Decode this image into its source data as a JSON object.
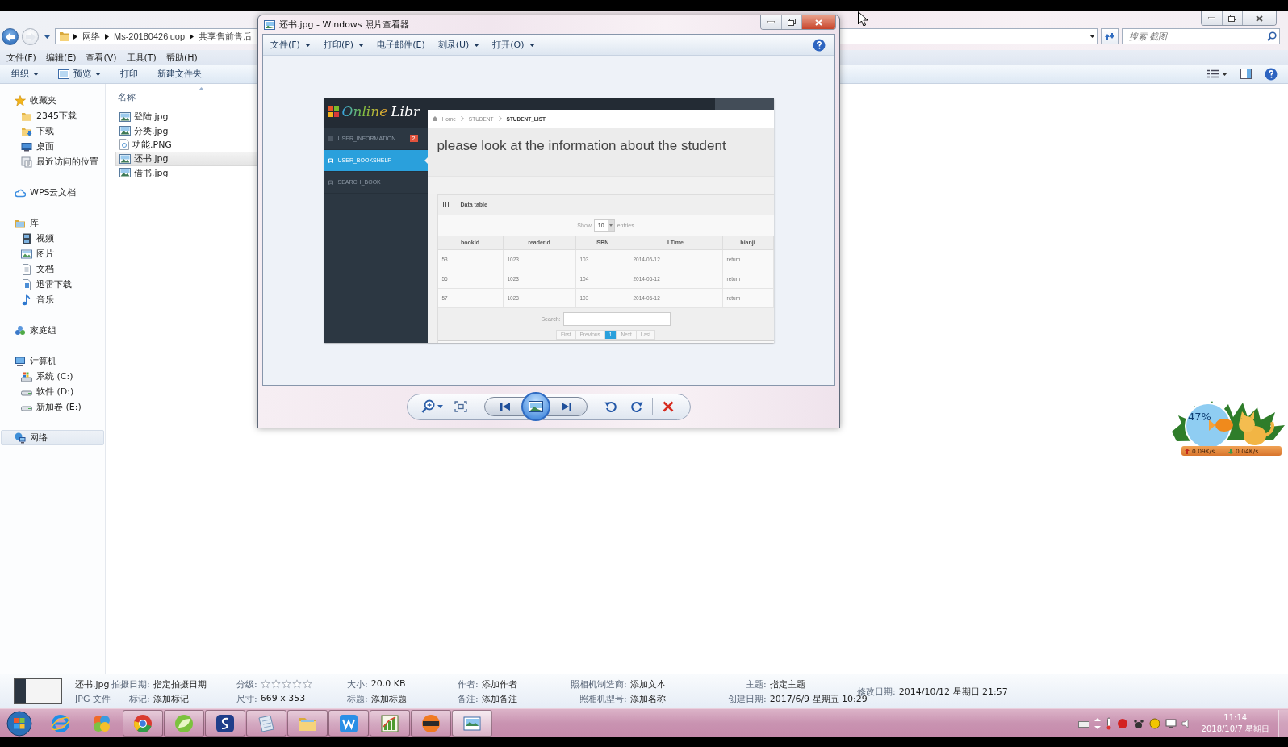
{
  "explorer": {
    "breadcrumb": [
      "网络",
      "Ms-20180426iuop",
      "共享售前售后"
    ],
    "search": {
      "placeholder": "搜索 截图"
    },
    "menu": [
      "文件(F)",
      "编辑(E)",
      "查看(V)",
      "工具(T)",
      "帮助(H)"
    ],
    "toolbar": [
      {
        "label": "组织",
        "kind": "dropdown"
      },
      {
        "label": "预览",
        "kind": "icon-dropdown"
      },
      {
        "label": "打印",
        "kind": "plain"
      },
      {
        "label": "新建文件夹",
        "kind": "plain"
      }
    ],
    "nav": [
      {
        "label": "收藏夹",
        "kind": "star",
        "selected": false,
        "children": [
          {
            "label": "2345下载",
            "kind": "folder",
            "selected": false
          },
          {
            "label": "下载",
            "kind": "download",
            "selected": false
          },
          {
            "label": "桌面",
            "kind": "desktop",
            "selected": false
          },
          {
            "label": "最近访问的位置",
            "kind": "recent",
            "selected": false
          }
        ]
      },
      {
        "label": "WPS云文档",
        "kind": "cloud",
        "selected": false
      },
      {
        "label": "库",
        "kind": "library",
        "selected": false,
        "children": [
          {
            "label": "视频",
            "kind": "video",
            "selected": false
          },
          {
            "label": "图片",
            "kind": "picture",
            "selected": false
          },
          {
            "label": "文档",
            "kind": "document",
            "selected": false
          },
          {
            "label": "迅雷下载",
            "kind": "thunder",
            "selected": false
          },
          {
            "label": "音乐",
            "kind": "music",
            "selected": false
          }
        ]
      },
      {
        "label": "家庭组",
        "kind": "homegroup",
        "selected": false
      },
      {
        "label": "计算机",
        "kind": "computer",
        "selected": false,
        "children": [
          {
            "label": "系统 (C:)",
            "kind": "system-drive",
            "selected": false
          },
          {
            "label": "软件 (D:)",
            "kind": "drive",
            "selected": false
          },
          {
            "label": "新加卷 (E:)",
            "kind": "drive",
            "selected": false
          }
        ]
      },
      {
        "label": "网络",
        "kind": "network",
        "selected": true
      }
    ],
    "column": "名称",
    "files": [
      {
        "name": "登陆.jpg",
        "kind": "image",
        "selected": false
      },
      {
        "name": "分类.jpg",
        "kind": "image",
        "selected": false
      },
      {
        "name": "功能.PNG",
        "kind": "file",
        "selected": false
      },
      {
        "name": "还书.jpg",
        "kind": "image",
        "selected": true
      },
      {
        "name": "借书.jpg",
        "kind": "image",
        "selected": false
      }
    ],
    "details": {
      "name": "还书.jpg",
      "type": "JPG 文件",
      "columns": [
        [
          {
            "label": "拍摄日期:",
            "kind": "text",
            "value": "指定拍摄日期"
          },
          {
            "label": "标记:",
            "kind": "text",
            "value": "添加标记"
          }
        ],
        [
          {
            "label": "分级:",
            "kind": "rating",
            "stars": 0
          },
          {
            "label": "尺寸:",
            "kind": "text",
            "value": "669 x 353"
          }
        ],
        [
          {
            "label": "大小:",
            "kind": "text",
            "value": "20.0 KB"
          },
          {
            "label": "标题:",
            "kind": "text",
            "value": "添加标题"
          }
        ],
        [
          {
            "label": "作者:",
            "kind": "text",
            "value": "添加作者"
          },
          {
            "label": "备注:",
            "kind": "text",
            "value": "添加备注"
          }
        ],
        [
          {
            "label": "照相机制造商:",
            "kind": "text",
            "value": "添加文本"
          },
          {
            "label": "照相机型号:",
            "kind": "text",
            "value": "添加名称"
          }
        ],
        [
          {
            "label": "主题:",
            "kind": "text",
            "value": "指定主题"
          },
          {
            "label": "创建日期:",
            "kind": "text",
            "value": "2017/6/9 星期五 10:29"
          }
        ],
        [
          {
            "label": "修改日期:",
            "kind": "text",
            "value": "2014/10/12 星期日 21:57"
          }
        ]
      ]
    }
  },
  "viewer": {
    "title": "还书.jpg - Windows 照片查看器",
    "menu": [
      {
        "label": "文件(F)",
        "dropdown": true
      },
      {
        "label": "打印(P)",
        "dropdown": true
      },
      {
        "label": "电子邮件(E)",
        "dropdown": false
      },
      {
        "label": "刻录(U)",
        "dropdown": true
      },
      {
        "label": "打开(O)",
        "dropdown": true
      }
    ],
    "page": {
      "logo_accent": "Online",
      "logo_rest": "Libr",
      "menu": [
        {
          "label": "USER_INFORMATION",
          "badge": "2",
          "selected": false
        },
        {
          "label": "USER_BOOKSHELF",
          "selected": true
        },
        {
          "label": "SEARCH_BOOK",
          "selected": false
        }
      ],
      "breadcrumb": [
        "Home",
        "STUDENT",
        "STUDENT_LIST"
      ],
      "heading": "please look at the information about the student",
      "panel_title": "Data table",
      "show_label": "Show",
      "page_size": "10",
      "entries_label": "entries",
      "columns": [
        "bookId",
        "readerId",
        "ISBN",
        "LTime",
        "bianji"
      ],
      "rows": [
        [
          "53",
          "1023",
          "103",
          "2014-06-12",
          "return"
        ],
        [
          "56",
          "1023",
          "104",
          "2014-06-12",
          "return"
        ],
        [
          "57",
          "1023",
          "103",
          "2014-06-12",
          "return"
        ]
      ],
      "search_label": "Search:",
      "pagination": [
        {
          "label": "First",
          "selected": false
        },
        {
          "label": "Previous",
          "selected": false
        },
        {
          "label": "1",
          "selected": true
        },
        {
          "label": "Next",
          "selected": false
        },
        {
          "label": "Last",
          "selected": false
        }
      ]
    }
  },
  "taskbar": {
    "apps": [
      {
        "kind": "ie",
        "running": false,
        "selected": false
      },
      {
        "kind": "pinwheel",
        "running": false,
        "selected": false
      },
      {
        "kind": "chrome",
        "running": true,
        "selected": false
      },
      {
        "kind": "leaf",
        "running": true,
        "selected": false
      },
      {
        "kind": "swirl",
        "running": true,
        "selected": false
      },
      {
        "kind": "notepad",
        "running": true,
        "selected": false
      },
      {
        "kind": "folder",
        "running": true,
        "selected": false
      },
      {
        "kind": "zigzag",
        "running": true,
        "selected": false
      },
      {
        "kind": "chart",
        "running": true,
        "selected": false
      },
      {
        "kind": "mascot",
        "running": true,
        "selected": false
      },
      {
        "kind": "photo",
        "running": true,
        "selected": true
      }
    ],
    "time": "11:14",
    "date": "2018/10/7 星期日"
  },
  "widget": {
    "percent": "47%",
    "upload": "0.09K/s",
    "download": "0.04K/s"
  }
}
